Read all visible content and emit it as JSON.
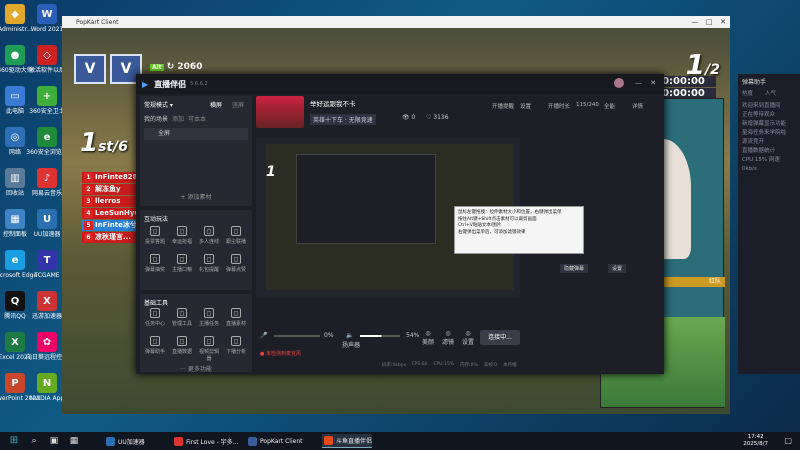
{
  "desktop": {
    "icons_left": [
      {
        "label": "Administr...",
        "color": "#e1a82c",
        "glyph": "◆"
      },
      {
        "label": "360驱动大师",
        "color": "#1f9c55",
        "glyph": "●"
      },
      {
        "label": "此电脑",
        "color": "#3a7bd5",
        "glyph": "▭"
      },
      {
        "label": "网络",
        "color": "#2f6fb5",
        "glyph": "◎"
      },
      {
        "label": "回收站",
        "color": "#5b7a99",
        "glyph": "▥"
      },
      {
        "label": "控制面板",
        "color": "#3f83c7",
        "glyph": "▦"
      },
      {
        "label": "Microsoft Edge",
        "color": "#1b9de2",
        "glyph": "e"
      },
      {
        "label": "腾讯QQ",
        "color": "#111",
        "glyph": "Q"
      },
      {
        "label": "Excel 2021",
        "color": "#1d7a44",
        "glyph": "X"
      },
      {
        "label": "PowerPoint 2021",
        "color": "#c8472b",
        "glyph": "P"
      }
    ],
    "icons_right": [
      {
        "label": "Word 2021",
        "color": "#2b5eb8",
        "glyph": "W"
      },
      {
        "label": "激活软件以后",
        "color": "#c22",
        "glyph": "◇"
      },
      {
        "label": "360安全卫士",
        "color": "#3fae3a",
        "glyph": "+"
      },
      {
        "label": "360安全浏览器",
        "color": "#1f8a3a",
        "glyph": "e"
      },
      {
        "label": "网易云音乐",
        "color": "#d33",
        "glyph": "♪"
      },
      {
        "label": "UU加速器",
        "color": "#2a6fb0",
        "glyph": "U"
      },
      {
        "label": "TCGAME",
        "color": "#33a",
        "glyph": "T"
      },
      {
        "label": "迅游加速器",
        "color": "#c33",
        "glyph": "X"
      },
      {
        "label": "向日葵远程控制",
        "color": "#e06",
        "glyph": "✿"
      },
      {
        "label": "NVIDIA App",
        "color": "#6a2",
        "glyph": "N"
      }
    ]
  },
  "game_window": {
    "title": "PopKart Client",
    "hud": {
      "alt_label": "Alt",
      "score": "2060",
      "card1": "V",
      "card2": "V"
    },
    "rank": {
      "place": "1",
      "suffix": "st",
      "total": "/6"
    },
    "players": [
      {
        "num": "1",
        "name": "InFinte828",
        "color": "#c81c1c"
      },
      {
        "num": "2",
        "name": "解冻鱼y",
        "color": "#c81c1c"
      },
      {
        "num": "3",
        "name": "llerros",
        "color": "#c81c1c"
      },
      {
        "num": "4",
        "name": "LeeSunHyun",
        "color": "#c81c1c"
      },
      {
        "num": "5",
        "name": "InFinte冰兮",
        "color": "#2a7fd6"
      },
      {
        "num": "6",
        "name": "凉秋瑾言...",
        "color": "#c81c1c"
      }
    ],
    "lap": {
      "current": "1",
      "total": "/2"
    },
    "timers": [
      "00:00:00",
      "00:00:00",
      "00:00:00"
    ],
    "team_label": "红队"
  },
  "live_companion": {
    "app_name": "直播伴侣",
    "version": "5.6.6.2",
    "mode_select": "常规模式",
    "layout_tabs": [
      "横屏",
      "竖屏"
    ],
    "scene_label": "我的场景",
    "scene_tabs": [
      "添加",
      "可本本"
    ],
    "source_name": "全屏",
    "add_source": "+ 添加素材",
    "stream_title": "举好运跟我不卡",
    "stream_author": "虎牙主播",
    "stream_tags": [
      "英雄十下车 · 无限竞速",
      "竞速"
    ],
    "viewers": "0",
    "likes": "3136",
    "header_links": [
      "开播提醒",
      "设置",
      "开播时长",
      "115/240",
      "全能",
      "详情"
    ],
    "interactive_title": "互动玩法",
    "interactive_tools": [
      "投票答题",
      "幸运抢福",
      "多人连线",
      "跟尘联播",
      "弹幕抽奖",
      "主播口粮",
      "礼包提醒",
      "弹幕点赞"
    ],
    "basic_title": "基础工具",
    "basic_tools": [
      "任务中心",
      "管理工具",
      "主播任务",
      "直播素材",
      "弹幕助手",
      "直播数据",
      "视频剪辑器",
      "下播分析"
    ],
    "more_label": "更多功能",
    "bottom": {
      "mic_label": "麦克风",
      "mic_pct": "0%",
      "speaker_label": "扬声器",
      "speaker_pct": "54%",
      "extra_btns": [
        "美颜",
        "滤镜",
        "设置"
      ],
      "live_button": "连接中..."
    },
    "warning_text": "未检测到麦克风",
    "status_bar": [
      "码率:0kbps",
      "FPS:60",
      "CPU:15%",
      "内存:0%",
      "丢帧:0",
      "本月播"
    ],
    "tooltip_lines": [
      "鼠标左键拖拽：拉伸素材大小和位置，右键弹出菜单",
      "按住Alt键+Shift点击素材可以裁剪画面",
      "Ctrl+V粘贴文本/图片",
      "右键弹出菜单后，可添加滤镜效果"
    ],
    "side_buttons": [
      "隐藏弹幕",
      "设置"
    ]
  },
  "chat_panel": {
    "title": "弹幕助手",
    "tabs": [
      "热度",
      "人气"
    ],
    "lines": [
      "欢迎来到直播间",
      "正在等待观众",
      "新增弹幕显示功能",
      "星海任务来学院啦",
      "源流竞开",
      "直播数据统计",
      "CPU 15%  网速 0kb/s"
    ]
  },
  "taskbar": {
    "apps": [
      {
        "label": "UU加速器",
        "color": "#2a6fb0",
        "active": false
      },
      {
        "label": "First Love - 宇多...",
        "color": "#d33",
        "active": false
      },
      {
        "label": "PopKart Client",
        "color": "#3a5a9a",
        "active": false
      },
      {
        "label": "斗鱼直播伴侣",
        "color": "#e64a19",
        "active": true
      }
    ],
    "time": "17:42",
    "date": "2025/8/7"
  }
}
